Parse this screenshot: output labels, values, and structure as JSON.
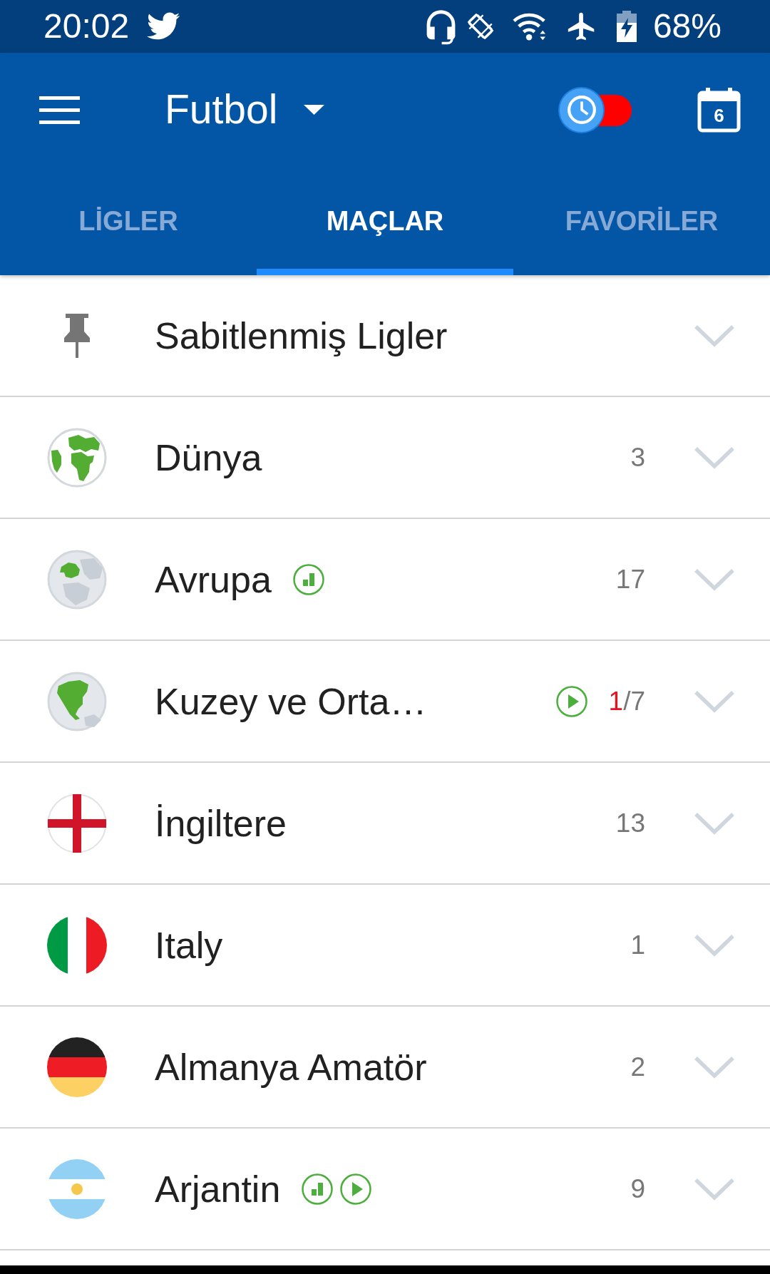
{
  "status_bar": {
    "time": "20:02",
    "battery": "68%"
  },
  "app_bar": {
    "title": "Futbol",
    "live_toggle": {
      "on": false
    },
    "calendar_day": "6"
  },
  "tabs": [
    {
      "label": "LİGLER",
      "selected": false
    },
    {
      "label": "MAÇLAR",
      "selected": true
    },
    {
      "label": "FAVORİLER",
      "selected": false
    }
  ],
  "leagues": [
    {
      "kind": "pinned",
      "name": "Sabitlenmiş Ligler",
      "expanded": false
    },
    {
      "kind": "world",
      "name": "Dünya",
      "count": "3",
      "expanded": false
    },
    {
      "kind": "europe",
      "name": "Avrupa",
      "badges": [
        {
          "kind": "stats"
        }
      ],
      "count": "17",
      "expanded": false
    },
    {
      "kind": "americas",
      "name": "Kuzey ve Orta…",
      "count_badges": [
        {
          "kind": "live"
        }
      ],
      "live_count": "1",
      "count": "/7",
      "expanded": false
    },
    {
      "kind": "england",
      "name": "İngiltere",
      "count": "13",
      "expanded": false
    },
    {
      "kind": "italy",
      "name": "Italy",
      "count": "1",
      "expanded": false
    },
    {
      "kind": "germany",
      "name": "Almanya Amatör",
      "count": "2",
      "expanded": false
    },
    {
      "kind": "argentina",
      "name": "Arjantin",
      "badges": [
        {
          "kind": "stats"
        },
        {
          "kind": "live"
        }
      ],
      "count": "9",
      "expanded": false
    }
  ]
}
